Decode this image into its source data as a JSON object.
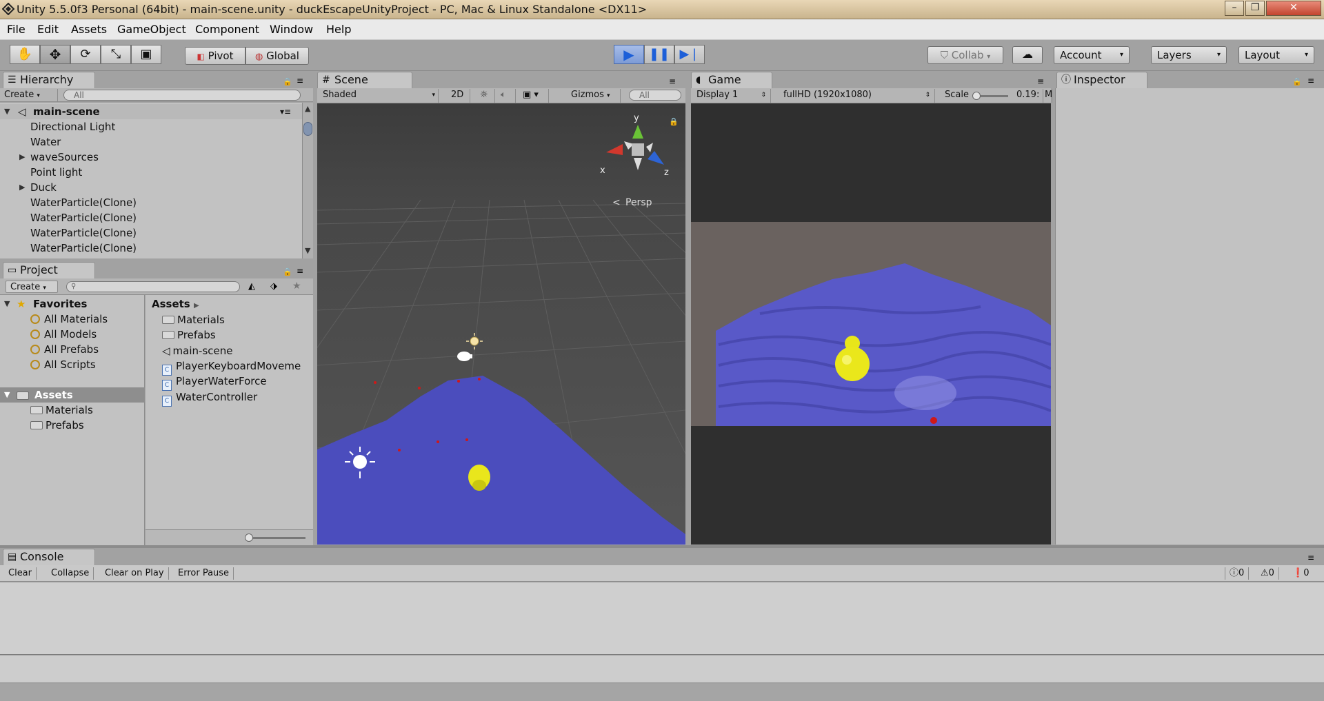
{
  "window": {
    "title": "Unity 5.5.0f3 Personal (64bit) - main-scene.unity - duckEscapeUnityProject - PC, Mac & Linux Standalone <DX11>",
    "controls": [
      "–",
      "❐",
      "✕"
    ]
  },
  "menu": [
    "File",
    "Edit",
    "Assets",
    "GameObject",
    "Component",
    "Window",
    "Help"
  ],
  "toolbar": {
    "pivot_label": "Pivot",
    "global_label": "Global",
    "collab_label": "Collab",
    "account_label": "Account",
    "layers_label": "Layers",
    "layout_label": "Layout"
  },
  "hierarchy": {
    "tab_label": "Hierarchy",
    "create_label": "Create",
    "search_placeholder": "All",
    "scene_name": "main-scene",
    "items": [
      {
        "label": "Directional Light",
        "expandable": false
      },
      {
        "label": "Water",
        "expandable": false
      },
      {
        "label": "waveSources",
        "expandable": true
      },
      {
        "label": "Point light",
        "expandable": false
      },
      {
        "label": "Duck",
        "expandable": true
      },
      {
        "label": "WaterParticle(Clone)",
        "expandable": false
      },
      {
        "label": "WaterParticle(Clone)",
        "expandable": false
      },
      {
        "label": "WaterParticle(Clone)",
        "expandable": false
      },
      {
        "label": "WaterParticle(Clone)",
        "expandable": false
      }
    ]
  },
  "project": {
    "tab_label": "Project",
    "create_label": "Create",
    "favorites_label": "Favorites",
    "favorites": [
      "All Materials",
      "All Models",
      "All Prefabs",
      "All Scripts"
    ],
    "assets_label": "Assets",
    "assets_tree": [
      "Materials",
      "Prefabs"
    ],
    "breadcrumb": "Assets",
    "assets_list": [
      {
        "label": "Materials",
        "kind": "folder"
      },
      {
        "label": "Prefabs",
        "kind": "folder"
      },
      {
        "label": "main-scene",
        "kind": "scene"
      },
      {
        "label": "PlayerKeyboardMoveme",
        "kind": "script"
      },
      {
        "label": "PlayerWaterForce",
        "kind": "script"
      },
      {
        "label": "WaterController",
        "kind": "script"
      }
    ]
  },
  "scene": {
    "tab_label": "Scene",
    "shading": "Shaded",
    "mode_2d": "2D",
    "gizmos_label": "Gizmos",
    "search_placeholder": "All",
    "gizmo_axes": {
      "y": "y",
      "x": "x",
      "z": "z"
    },
    "projection_label": "Persp",
    "colors": {
      "water": "#4b4dbd",
      "duck": "#e9e61c",
      "particle": "#d01818"
    }
  },
  "game": {
    "tab_label": "Game",
    "display": "Display 1",
    "resolution": "fullHD (1920x1080)",
    "scale_label": "Scale",
    "scale_value": "0.19:",
    "maximize_hint": "M"
  },
  "inspector": {
    "tab_label": "Inspector"
  },
  "console": {
    "tab_label": "Console",
    "buttons": [
      "Clear",
      "Collapse",
      "Clear on Play",
      "Error Pause"
    ],
    "counts": {
      "info": "0",
      "warning": "0",
      "error": "0"
    }
  }
}
